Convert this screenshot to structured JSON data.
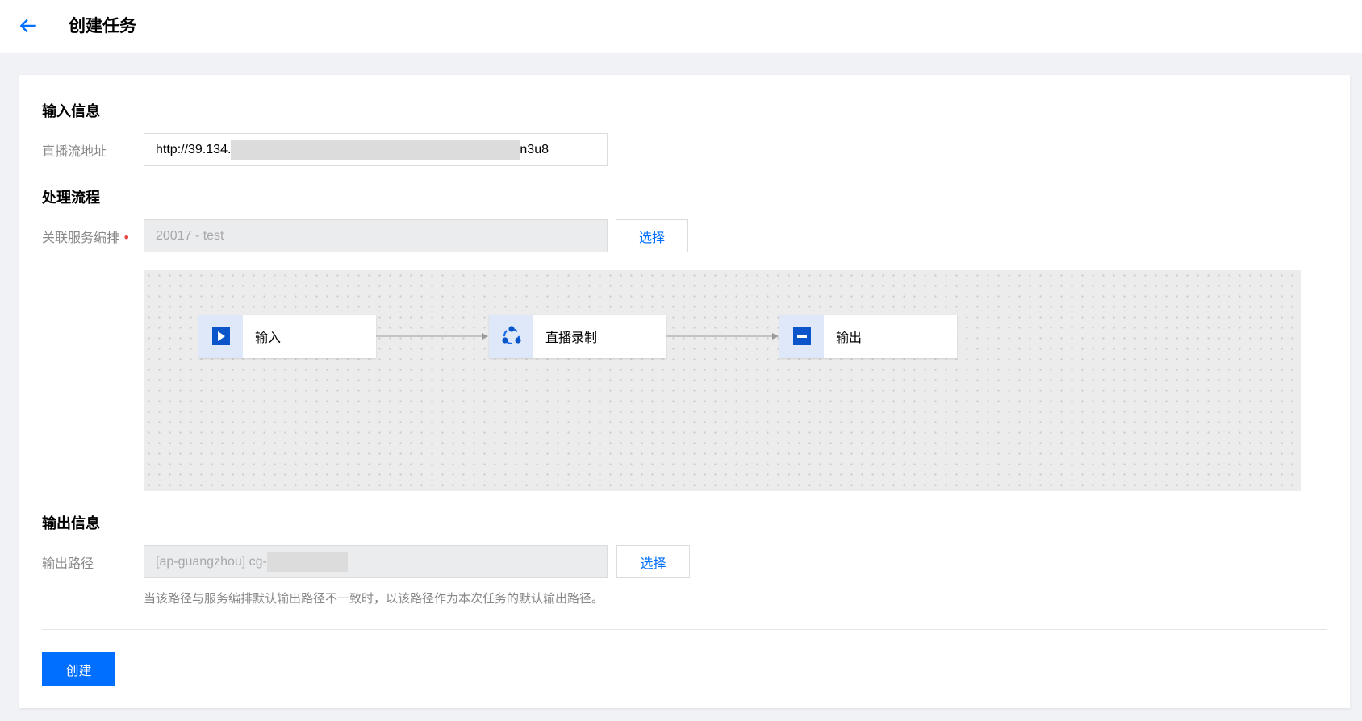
{
  "header": {
    "title": "创建任务",
    "back_icon": "arrow-left-icon"
  },
  "input_section": {
    "title": "输入信息",
    "stream_label": "直播流地址",
    "stream_value_prefix": "http://39.134.",
    "stream_value_suffix": "n3u8"
  },
  "process_section": {
    "title": "处理流程",
    "orchestration_label": "关联服务编排",
    "required_mark": "•",
    "orchestration_value": "20017 - test",
    "select_label": "选择",
    "nodes": [
      {
        "label": "输入",
        "icon": "play-icon"
      },
      {
        "label": "直播录制",
        "icon": "record-cycle-icon"
      },
      {
        "label": "输出",
        "icon": "output-icon"
      }
    ]
  },
  "output_section": {
    "title": "输出信息",
    "path_label": "输出路径",
    "path_value_prefix": "[ap-guangzhou] cg-",
    "select_label": "选择",
    "hint": "当该路径与服务编排默认输出路径不一致时，以该路径作为本次任务的默认输出路径。"
  },
  "footer": {
    "create_label": "创建"
  },
  "colors": {
    "primary": "#006eff",
    "node_icon_bg": "#dfe8f8",
    "canvas_bg": "#ececec"
  }
}
